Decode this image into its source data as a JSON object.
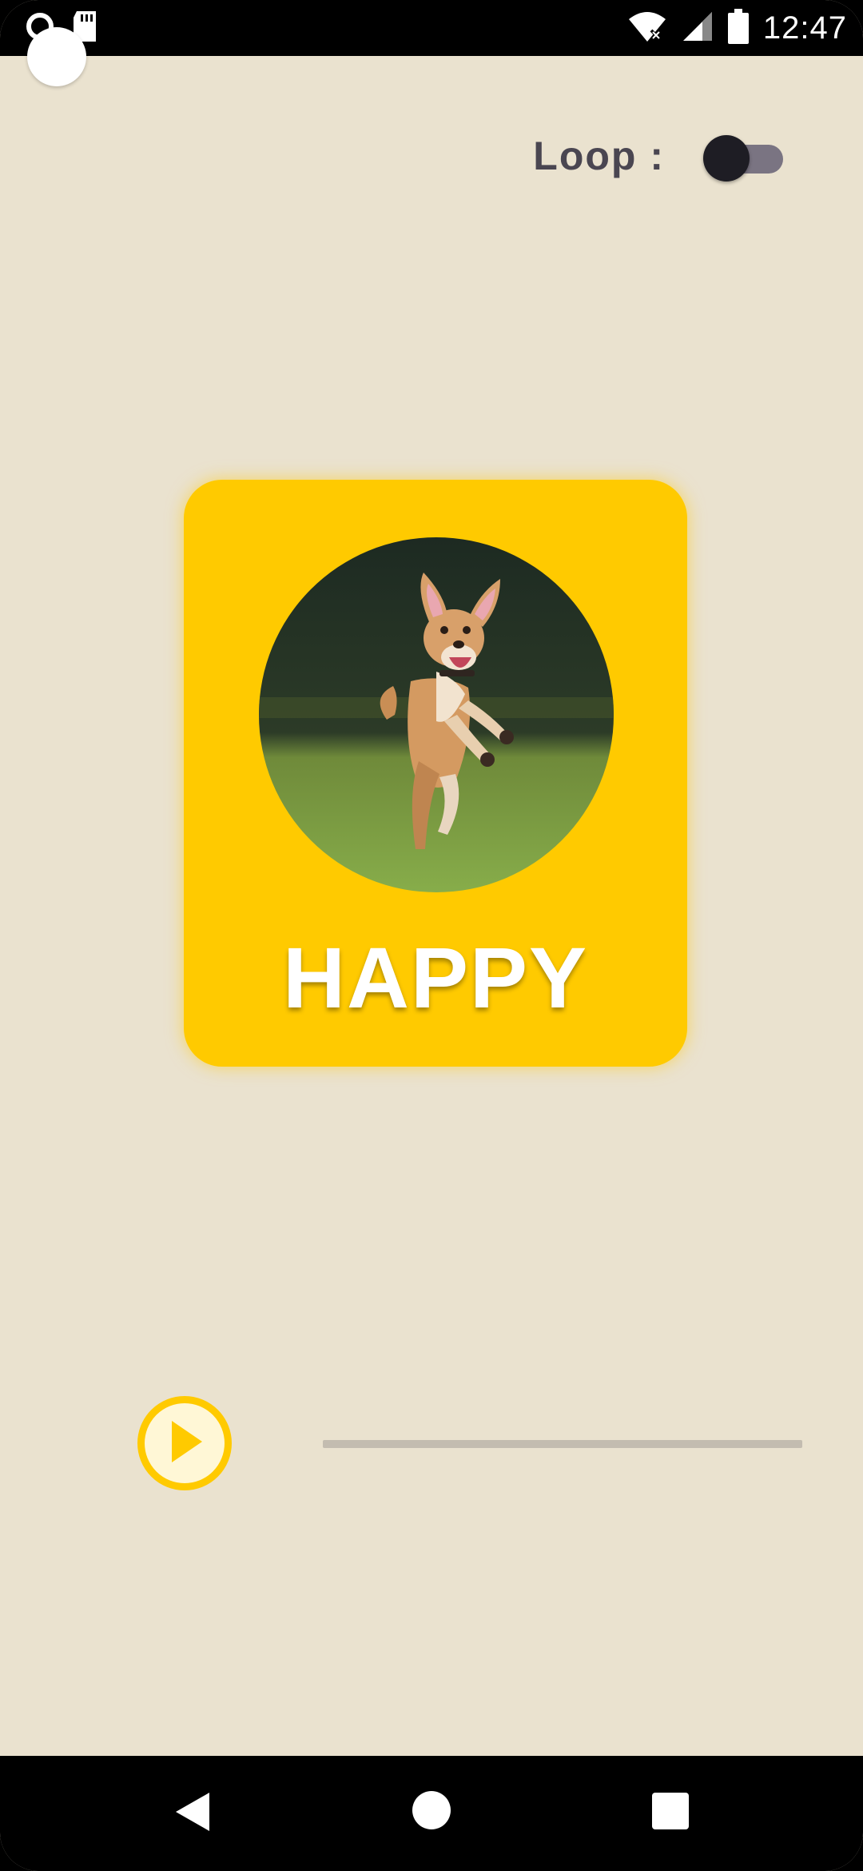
{
  "status_bar": {
    "time": "12:47",
    "icons": [
      "notification-icon",
      "sd-card-icon",
      "wifi-icon",
      "cellular-icon",
      "battery-icon"
    ]
  },
  "loop": {
    "label": "Loop :",
    "enabled": false
  },
  "card": {
    "title": "HAPPY",
    "image_subject": "dog-running-on-grass",
    "background_color": "#FFCA00"
  },
  "player": {
    "state": "paused",
    "progress": 0,
    "accent_color": "#FFCA00"
  },
  "nav_bar": {
    "buttons": [
      "back",
      "home",
      "recents"
    ]
  },
  "colors": {
    "page_background": "#EAE2CF",
    "text_dark": "#4a4651"
  }
}
